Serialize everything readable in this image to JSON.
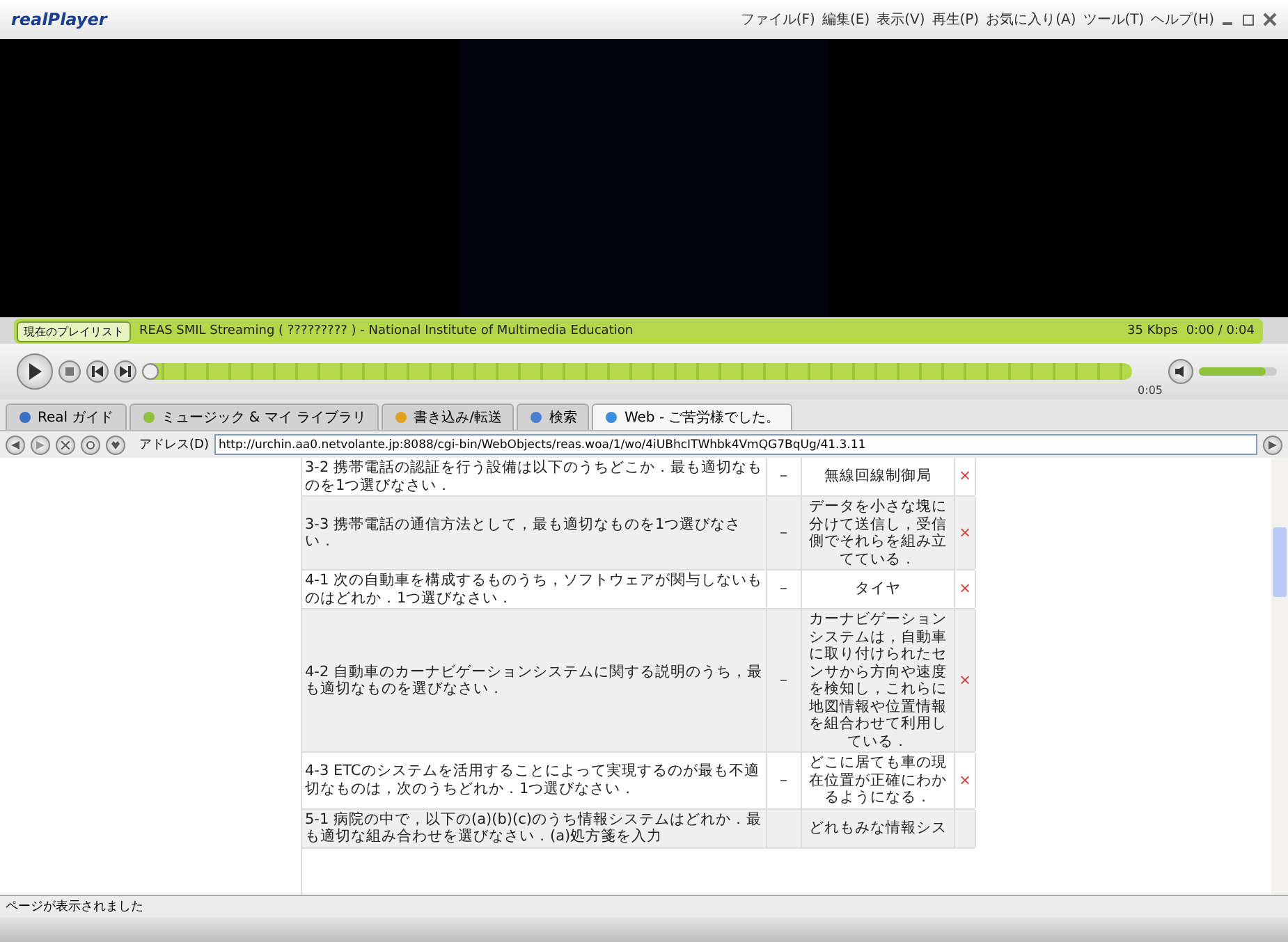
{
  "window": {
    "app_name": "realPlayer",
    "menu": [
      "ファイル(F)",
      "編集(E)",
      "表示(V)",
      "再生(P)",
      "お気に入り(A)",
      "ツール(T)",
      "ヘルプ(H)"
    ]
  },
  "playlist_bar": {
    "playlist_button": "現在のプレイリスト",
    "clip_title": "REAS SMIL Streaming ( ????????? ) - National Institute of Multimedia Education",
    "bitrate": "35 Kbps",
    "time": "0:00 / 0:04"
  },
  "seek": {
    "level": 0.0,
    "end_time": "0:05"
  },
  "volume": {
    "level": 0.85
  },
  "tabs": [
    {
      "label": "Real ガイド",
      "selected": false
    },
    {
      "label": "ミュージック & マイ ライブラリ",
      "selected": false
    },
    {
      "label": "書き込み/転送",
      "selected": false
    },
    {
      "label": "検索",
      "selected": false
    },
    {
      "label": "Web - ご苦労様でした。",
      "selected": true
    }
  ],
  "address_bar": {
    "label": "アドレス(D)",
    "url": "http://urchin.aa0.netvolante.jp:8088/cgi-bin/WebObjects/reas.woa/1/wo/4iUBhcITWhbk4VmQG7BqUg/41.3.11"
  },
  "results": [
    {
      "question": "3-2 携帯電話の認証を行う設備は以下のうちどこか．最も適切なものを1つ選びなさい．",
      "dash": "－",
      "answer": "無線回線制御局",
      "mark": "×"
    },
    {
      "question": "3-3 携帯電話の通信方法として，最も適切なものを1つ選びなさい．",
      "dash": "－",
      "answer": "データを小さな塊に分けて送信し，受信側でそれらを組み立てている．",
      "mark": "×"
    },
    {
      "question": "4-1 次の自動車を構成するものうち，ソフトウェアが関与しないものはどれか．1つ選びなさい．",
      "dash": "－",
      "answer": "タイヤ",
      "mark": "×"
    },
    {
      "question": "4-2 自動車のカーナビゲーションシステムに関する説明のうち，最も適切なものを選びなさい．",
      "dash": "－",
      "answer": "カーナビゲーションシステムは，自動車に取り付けられたセンサから方向や速度を検知し，これらに地図情報や位置情報を組合わせて利用している．",
      "mark": "×"
    },
    {
      "question": "4-3 ETCのシステムを活用することによって実現するのが最も不適切なものは，次のうちどれか．1つ選びなさい．",
      "dash": "－",
      "answer": "どこに居ても車の現在位置が正確にわかるようになる．",
      "mark": "×"
    },
    {
      "question": "5-1 病院の中で，以下の(a)(b)(c)のうち情報システムはどれか．最も適切な組み合わせを選びなさい．(a)処方箋を入力",
      "answer": "どれもみな情報シス"
    }
  ],
  "status_bar": "ページが表示されました"
}
